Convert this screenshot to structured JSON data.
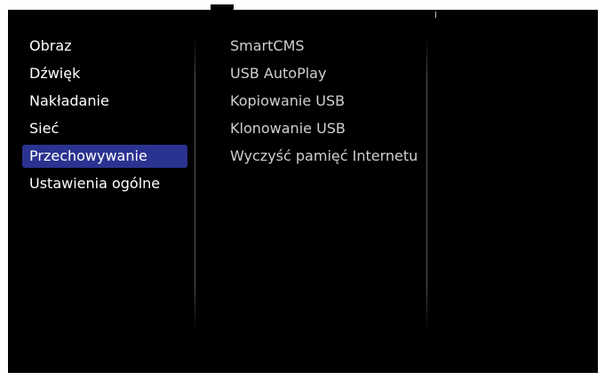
{
  "main_menu": {
    "items": [
      {
        "label": "Obraz"
      },
      {
        "label": "Dźwięk"
      },
      {
        "label": "Nakładanie"
      },
      {
        "label": "Sieć"
      },
      {
        "label": "Przechowywanie",
        "selected": true
      },
      {
        "label": "Ustawienia ogólne"
      }
    ]
  },
  "submenu": {
    "items": [
      {
        "label": "SmartCMS"
      },
      {
        "label": "USB AutoPlay"
      },
      {
        "label": "Kopiowanie USB"
      },
      {
        "label": "Klonowanie USB"
      },
      {
        "label": "Wyczyść pamięć Internetu"
      }
    ]
  },
  "colors": {
    "background": "#000000",
    "selection": "#2a3390",
    "text_primary": "#ffffff",
    "text_secondary": "#cfcfcf"
  }
}
